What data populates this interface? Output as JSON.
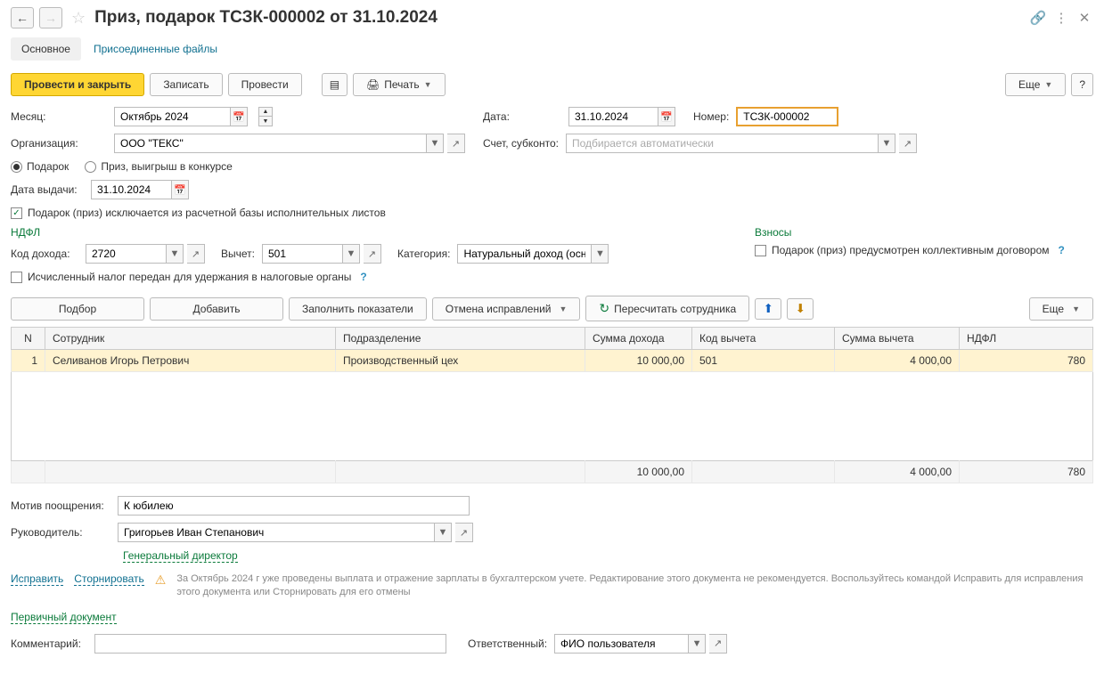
{
  "header": {
    "title": "Приз, подарок ТСЗК-000002 от 31.10.2024"
  },
  "tabs": {
    "main": "Основное",
    "files": "Присоединенные файлы"
  },
  "toolbar": {
    "post_close": "Провести и закрыть",
    "save": "Записать",
    "post": "Провести",
    "print": "Печать",
    "more": "Еще",
    "help": "?"
  },
  "form": {
    "month_label": "Месяц:",
    "month_value": "Октябрь 2024",
    "date_label": "Дата:",
    "date_value": "31.10.2024",
    "number_label": "Номер:",
    "number_value": "ТСЗК-000002",
    "org_label": "Организация:",
    "org_value": "ООО \"ТЕКС\"",
    "account_label": "Счет, субконто:",
    "account_placeholder": "Подбирается автоматически",
    "radio_gift": "Подарок",
    "radio_prize": "Приз, выигрыш в конкурсе",
    "issue_date_label": "Дата выдачи:",
    "issue_date_value": "31.10.2024",
    "exclude_checkbox": "Подарок (приз) исключается из расчетной базы исполнительных листов"
  },
  "ndfl": {
    "title": "НДФЛ",
    "code_label": "Код дохода:",
    "code_value": "2720",
    "deduct_label": "Вычет:",
    "deduct_value": "501",
    "category_label": "Категория:",
    "category_value": "Натуральный доход (осно",
    "tax_transferred": "Исчисленный налог передан для удержания в налоговые органы"
  },
  "contributions": {
    "title": "Взносы",
    "collective": "Подарок (приз) предусмотрен коллективным договором"
  },
  "table_toolbar": {
    "select": "Подбор",
    "add": "Добавить",
    "fill": "Заполнить показатели",
    "cancel_corr": "Отмена исправлений",
    "recalc": "Пересчитать сотрудника",
    "more": "Еще"
  },
  "table": {
    "col_n": "N",
    "col_employee": "Сотрудник",
    "col_dept": "Подразделение",
    "col_income": "Сумма дохода",
    "col_deduct_code": "Код вычета",
    "col_deduct_sum": "Сумма вычета",
    "col_ndfl": "НДФЛ",
    "rows": [
      {
        "n": "1",
        "employee": "Селиванов Игорь Петрович",
        "dept": "Производственный цех",
        "income": "10 000,00",
        "deduct_code": "501",
        "deduct_sum": "4 000,00",
        "ndfl": "780"
      }
    ],
    "totals": {
      "income": "10 000,00",
      "deduct_sum": "4 000,00",
      "ndfl": "780"
    }
  },
  "footer": {
    "motive_label": "Мотив поощрения:",
    "motive_value": "К юбилею",
    "manager_label": "Руководитель:",
    "manager_value": "Григорьев Иван Степанович",
    "manager_position": "Генеральный директор",
    "correct_link": "Исправить",
    "storno_link": "Сторнировать",
    "warning": "За Октябрь 2024 г уже проведены выплата и отражение зарплаты в бухгалтерском учете. Редактирование этого документа не рекомендуется. Воспользуйтесь командой Исправить для исправления этого документа или Сторнировать для его отмены",
    "primary_doc": "Первичный документ",
    "comment_label": "Комментарий:",
    "responsible_label": "Ответственный:",
    "responsible_value": "ФИО пользователя"
  }
}
